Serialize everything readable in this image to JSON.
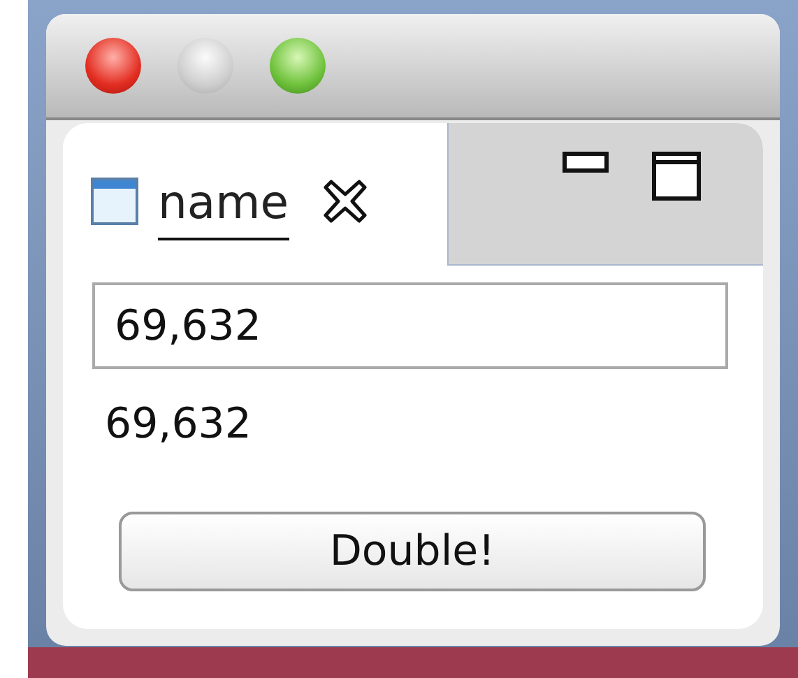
{
  "tabs": [
    {
      "label": "name",
      "selected": true
    }
  ],
  "field": {
    "value": "69,632"
  },
  "result": "69,632",
  "button": "Double!"
}
